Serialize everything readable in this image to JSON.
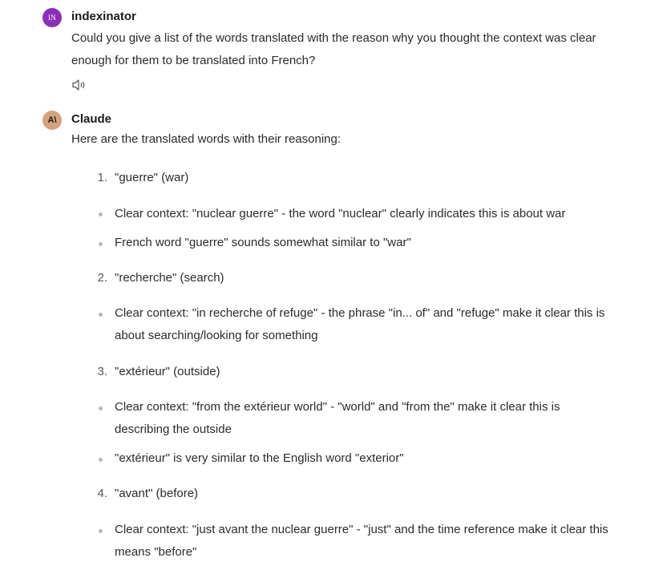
{
  "user_message": {
    "avatar_text": "IN",
    "author": "indexinator",
    "text": "Could you give a list of the words translated with the reason why you thought the context was clear enough for them to be translated into French?",
    "speaker_icon": "speaker-icon"
  },
  "assistant_message": {
    "avatar_text": "A\\",
    "author": "Claude",
    "intro": "Here are the translated words with their reasoning:",
    "items": [
      {
        "number": "1.",
        "title": "\"guerre\" (war)",
        "bullets": [
          "Clear context: \"nuclear guerre\" - the word \"nuclear\" clearly indicates this is about war",
          "French word \"guerre\" sounds somewhat similar to \"war\""
        ]
      },
      {
        "number": "2.",
        "title": "\"recherche\" (search)",
        "bullets": [
          "Clear context: \"in recherche of refuge\" - the phrase \"in... of\" and \"refuge\" make it clear this is about searching/looking for something"
        ]
      },
      {
        "number": "3.",
        "title": "\"extérieur\" (outside)",
        "bullets": [
          "Clear context: \"from the extérieur world\" - \"world\" and \"from the\" make it clear this is describing the outside",
          "\"extérieur\" is very similar to the English word \"exterior\""
        ]
      },
      {
        "number": "4.",
        "title": "\"avant\" (before)",
        "bullets": [
          "Clear context: \"just avant the nuclear guerre\" - \"just\" and the time reference make it clear this means \"before\""
        ]
      }
    ]
  },
  "colors": {
    "user_avatar": "#8b2fb8",
    "claude_avatar": "#d4a27f",
    "text": "#2b2b2b",
    "bullet": "#b8b8b8"
  }
}
